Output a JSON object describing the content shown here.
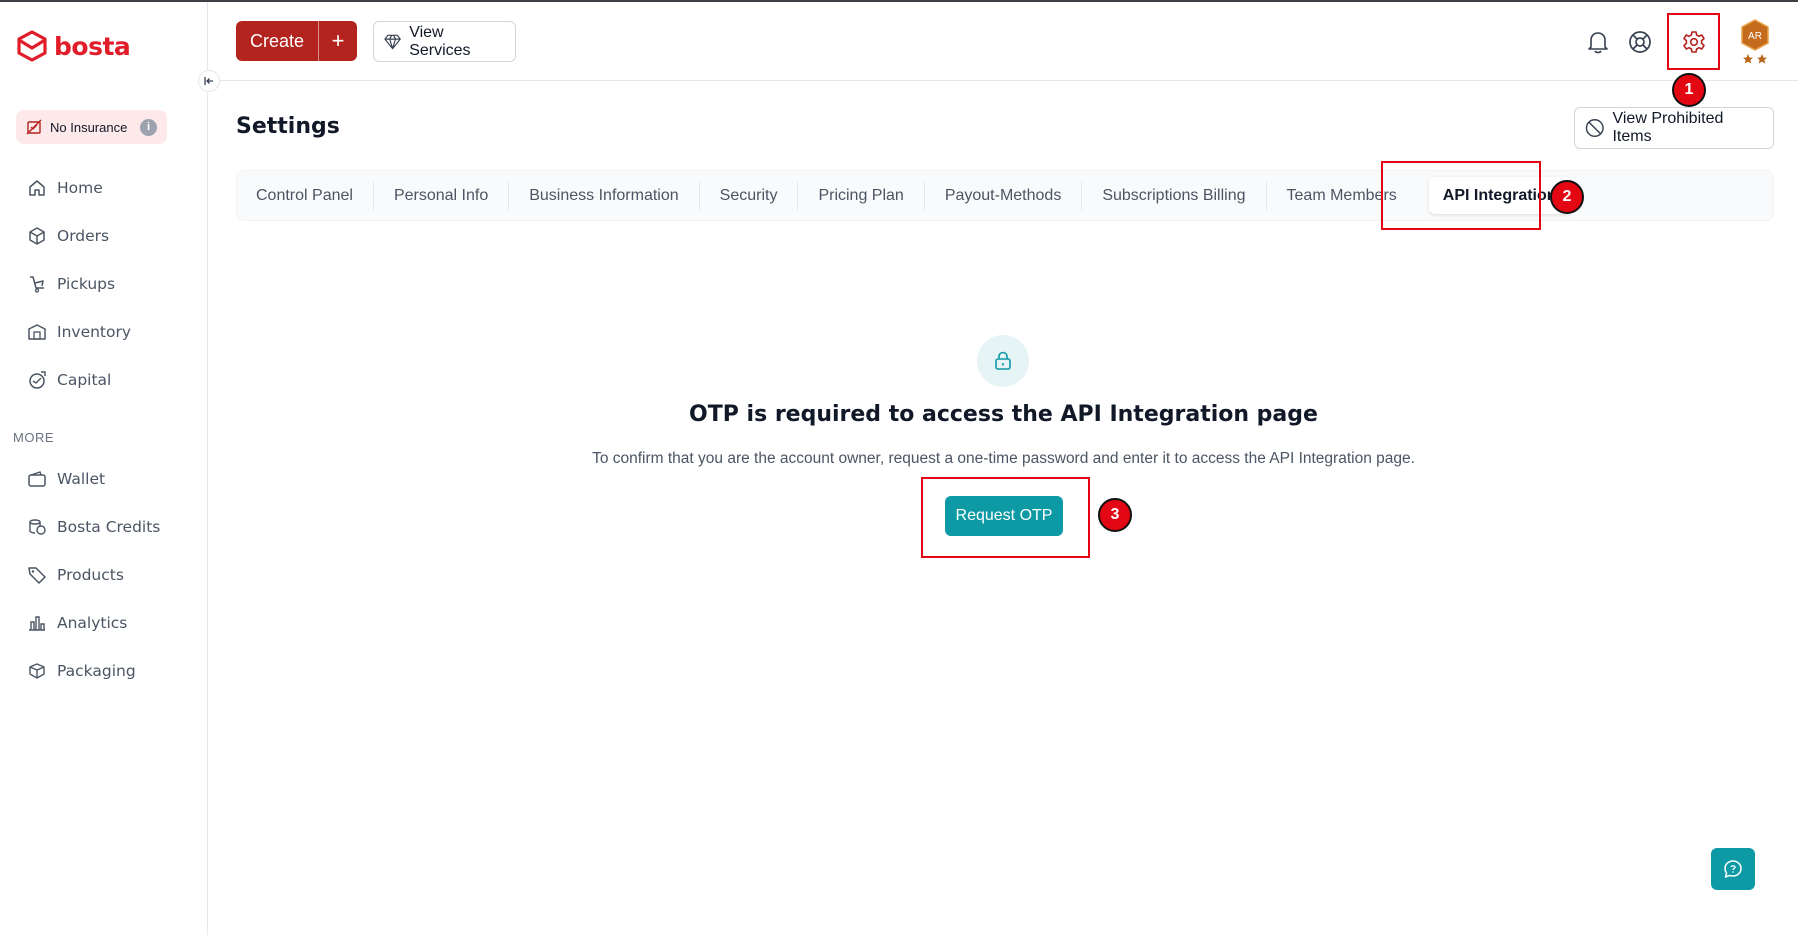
{
  "brand": {
    "name": "bosta",
    "color": "#e11d2a"
  },
  "sidebar": {
    "insurance_label": "No Insurance",
    "insurance_info": "i",
    "nav": [
      {
        "label": "Home",
        "icon": "home-icon"
      },
      {
        "label": "Orders",
        "icon": "box-icon"
      },
      {
        "label": "Pickups",
        "icon": "pickup-icon"
      },
      {
        "label": "Inventory",
        "icon": "warehouse-icon"
      },
      {
        "label": "Capital",
        "icon": "capital-icon"
      }
    ],
    "more_label": "MORE",
    "more": [
      {
        "label": "Wallet",
        "icon": "wallet-icon"
      },
      {
        "label": "Bosta Credits",
        "icon": "coins-icon"
      },
      {
        "label": "Products",
        "icon": "tag-icon"
      },
      {
        "label": "Analytics",
        "icon": "chart-icon"
      },
      {
        "label": "Packaging",
        "icon": "package-icon"
      }
    ]
  },
  "topbar": {
    "create_label": "Create",
    "create_plus": "+",
    "view_services_label": "View Services",
    "avatar_initials": "AR"
  },
  "page": {
    "title": "Settings",
    "prohibited_label": "View Prohibited Items",
    "tabs": [
      "Control Panel",
      "Personal Info",
      "Business Information",
      "Security",
      "Pricing Plan",
      "Payout-Methods",
      "Subscriptions Billing",
      "Team Members",
      "API Integration"
    ],
    "active_tab": "API Integration"
  },
  "otp": {
    "title": "OTP is required to access the API Integration page",
    "description": "To confirm that you are the account owner, request a one-time password and enter it to access the API Integration page.",
    "button_label": "Request OTP"
  },
  "annotations": {
    "step1": "1",
    "step2": "2",
    "step3": "3"
  },
  "colors": {
    "primary_red": "#b3241e",
    "teal": "#0e9aa5",
    "highlight": "#e30613"
  }
}
